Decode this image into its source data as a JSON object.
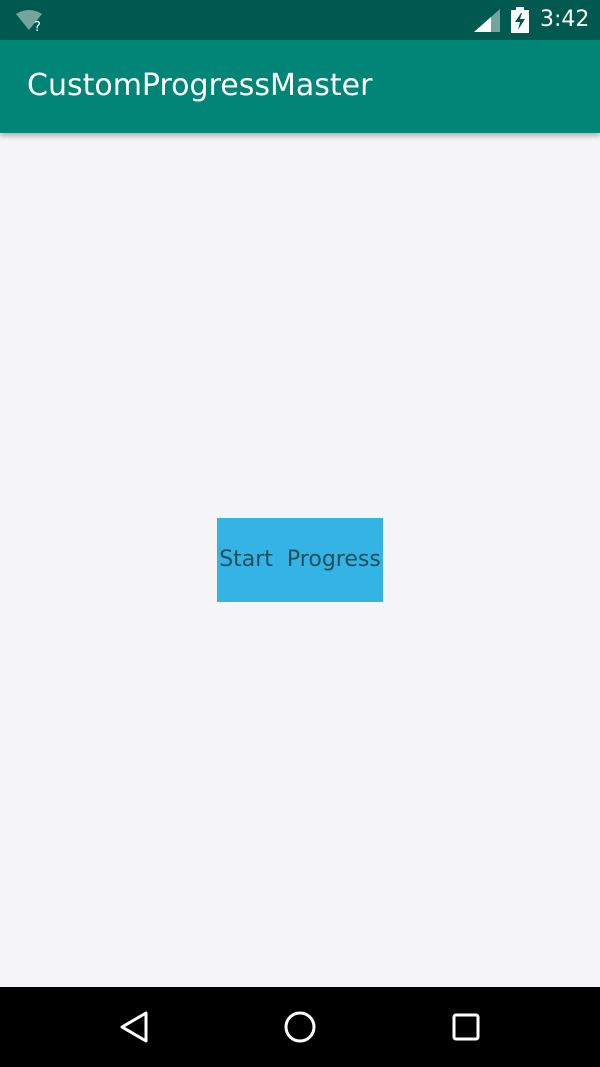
{
  "status_bar": {
    "time": "3:42",
    "wifi_icon": "wifi-unknown-icon",
    "signal_icon": "cell-signal-icon",
    "battery_icon": "battery-charging-icon",
    "wifi_badge": "?"
  },
  "app_bar": {
    "title": "CustomProgressMaster",
    "color": "#008577"
  },
  "main": {
    "start_button_label": "Start  Progress",
    "button_color": "#33b4e5"
  },
  "nav_bar": {
    "back_icon": "back-icon",
    "home_icon": "home-icon",
    "recents_icon": "recents-icon"
  }
}
